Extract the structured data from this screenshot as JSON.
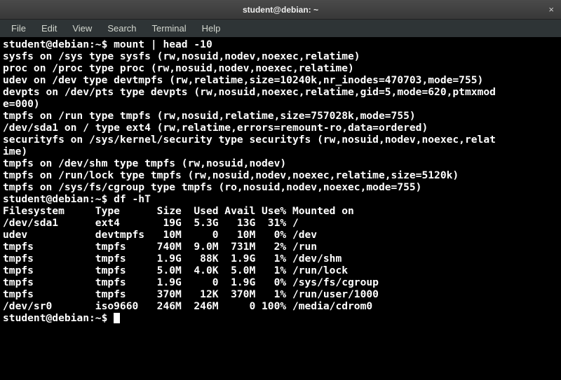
{
  "window": {
    "title": "student@debian: ~",
    "close_glyph": "×"
  },
  "menu": {
    "items": [
      "File",
      "Edit",
      "View",
      "Search",
      "Terminal",
      "Help"
    ]
  },
  "terminal": {
    "prompt": "student@debian:~$ ",
    "commands": {
      "cmd1": "mount | head -10",
      "cmd2": "df -hT",
      "cmd3": ""
    },
    "mount_output": [
      "sysfs on /sys type sysfs (rw,nosuid,nodev,noexec,relatime)",
      "proc on /proc type proc (rw,nosuid,nodev,noexec,relatime)",
      "udev on /dev type devtmpfs (rw,relatime,size=10240k,nr_inodes=470703,mode=755)",
      "devpts on /dev/pts type devpts (rw,nosuid,noexec,relatime,gid=5,mode=620,ptmxmode=000)",
      "tmpfs on /run type tmpfs (rw,nosuid,relatime,size=757028k,mode=755)",
      "/dev/sda1 on / type ext4 (rw,relatime,errors=remount-ro,data=ordered)",
      "securityfs on /sys/kernel/security type securityfs (rw,nosuid,nodev,noexec,relatime)",
      "tmpfs on /dev/shm type tmpfs (rw,nosuid,nodev)",
      "tmpfs on /run/lock type tmpfs (rw,nosuid,nodev,noexec,relatime,size=5120k)",
      "tmpfs on /sys/fs/cgroup type tmpfs (ro,nosuid,nodev,noexec,mode=755)"
    ],
    "df_header": "Filesystem     Type      Size  Used Avail Use% Mounted on",
    "df_rows": [
      "/dev/sda1      ext4       19G  5.3G   13G  31% /",
      "udev           devtmpfs   10M     0   10M   0% /dev",
      "tmpfs          tmpfs     740M  9.0M  731M   2% /run",
      "tmpfs          tmpfs     1.9G   88K  1.9G   1% /dev/shm",
      "tmpfs          tmpfs     5.0M  4.0K  5.0M   1% /run/lock",
      "tmpfs          tmpfs     1.9G     0  1.9G   0% /sys/fs/cgroup",
      "tmpfs          tmpfs     370M   12K  370M   1% /run/user/1000",
      "/dev/sr0       iso9660   246M  246M     0 100% /media/cdrom0"
    ]
  },
  "chart_data": {
    "type": "table",
    "title": "df -hT output",
    "columns": [
      "Filesystem",
      "Type",
      "Size",
      "Used",
      "Avail",
      "Use%",
      "Mounted on"
    ],
    "rows": [
      [
        "/dev/sda1",
        "ext4",
        "19G",
        "5.3G",
        "13G",
        "31%",
        "/"
      ],
      [
        "udev",
        "devtmpfs",
        "10M",
        "0",
        "10M",
        "0%",
        "/dev"
      ],
      [
        "tmpfs",
        "tmpfs",
        "740M",
        "9.0M",
        "731M",
        "2%",
        "/run"
      ],
      [
        "tmpfs",
        "tmpfs",
        "1.9G",
        "88K",
        "1.9G",
        "1%",
        "/dev/shm"
      ],
      [
        "tmpfs",
        "tmpfs",
        "5.0M",
        "4.0K",
        "5.0M",
        "1%",
        "/run/lock"
      ],
      [
        "tmpfs",
        "tmpfs",
        "1.9G",
        "0",
        "1.9G",
        "0%",
        "/sys/fs/cgroup"
      ],
      [
        "tmpfs",
        "tmpfs",
        "370M",
        "12K",
        "370M",
        "1%",
        "/run/user/1000"
      ],
      [
        "/dev/sr0",
        "iso9660",
        "246M",
        "246M",
        "0",
        "100%",
        "/media/cdrom0"
      ]
    ]
  }
}
